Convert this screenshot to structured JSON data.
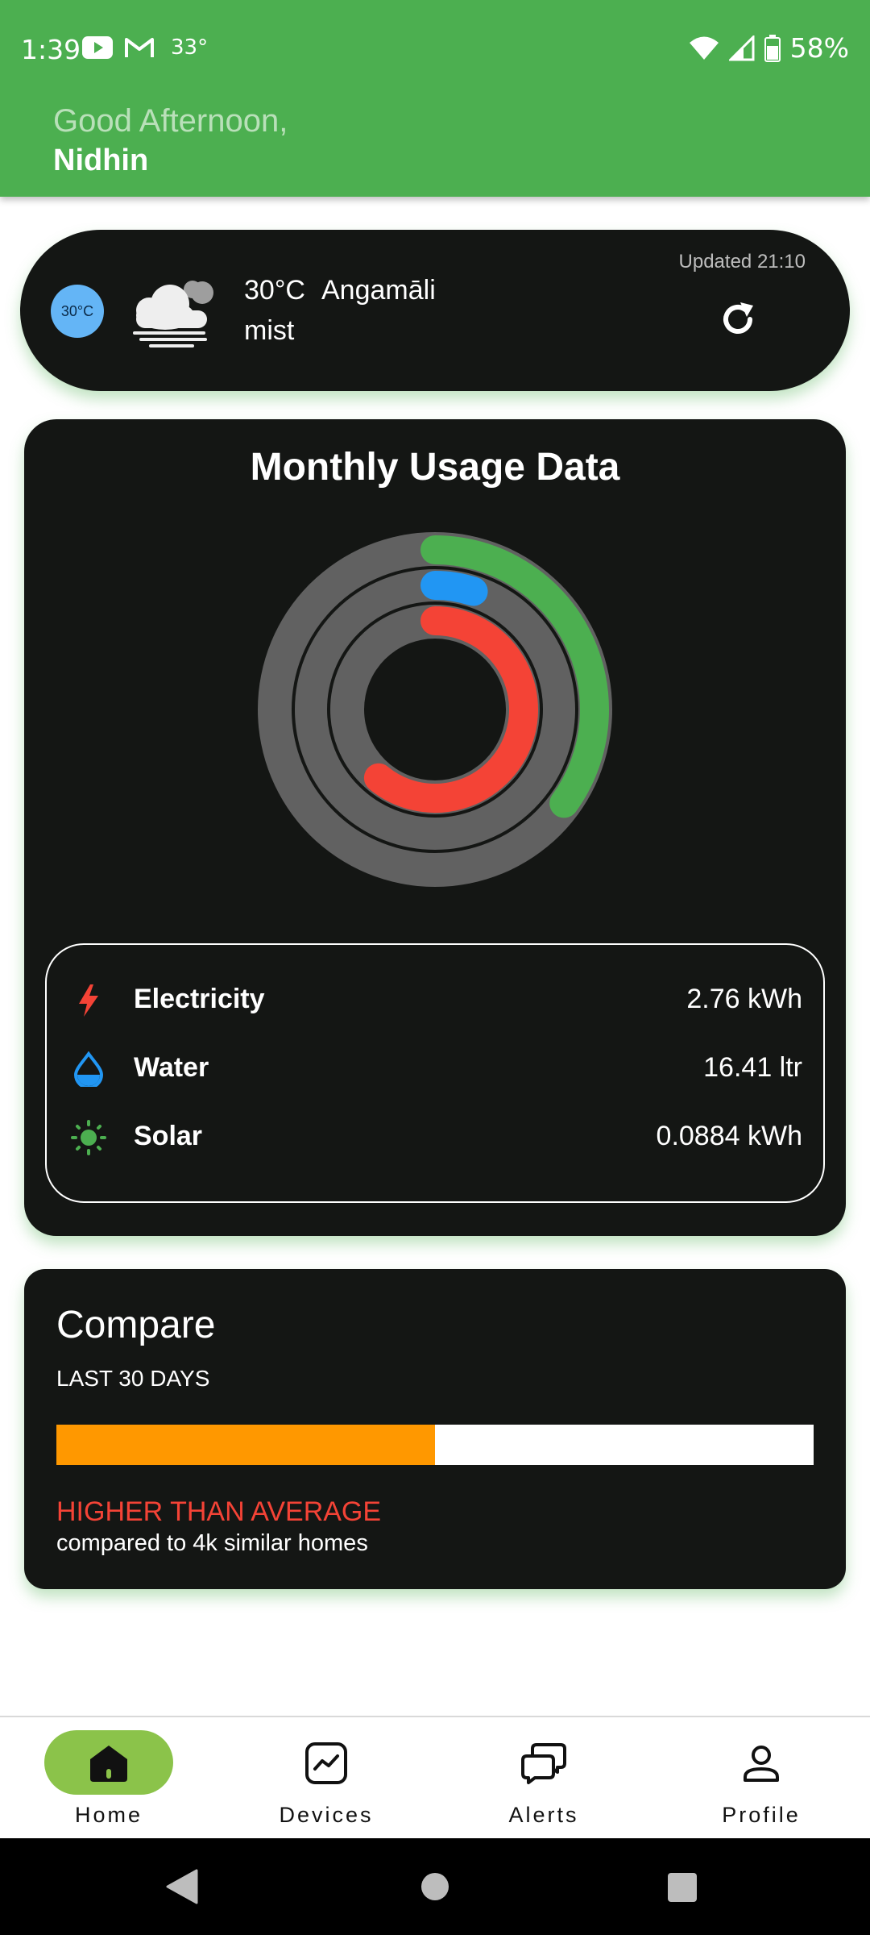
{
  "status_bar": {
    "time": "1:39",
    "temp": "33°",
    "battery": "58%"
  },
  "header": {
    "greeting": "Good Afternoon,",
    "username": "Nidhin"
  },
  "weather": {
    "badge": "30°C",
    "temperature": "30°C",
    "city": "Angamāli",
    "description": "mist",
    "updated": "Updated 21:10",
    "icon": "cloud-mist-icon"
  },
  "usage": {
    "title": "Monthly Usage Data",
    "rings": [
      {
        "name": "Solar",
        "color": "#4caf50",
        "fraction": 0.35
      },
      {
        "name": "Water",
        "color": "#2196f3",
        "fraction": 0.05
      },
      {
        "name": "Electricity",
        "color": "#f44336",
        "fraction": 0.61
      }
    ],
    "items": [
      {
        "label": "Electricity",
        "value": "2.76 kWh",
        "icon": "lightning-icon",
        "color": "#f44336"
      },
      {
        "label": "Water",
        "value": "16.41 ltr",
        "icon": "water-drop-icon",
        "color": "#2196f3"
      },
      {
        "label": "Solar",
        "value": "0.0884 kWh",
        "icon": "sun-icon",
        "color": "#4caf50"
      }
    ]
  },
  "compare": {
    "title": "Compare",
    "period": "LAST 30 DAYS",
    "fill_fraction": 0.5,
    "status": "HIGHER THAN AVERAGE",
    "note": "compared to 4k similar homes"
  },
  "nav": {
    "items": [
      {
        "label": "Home",
        "icon": "home-icon",
        "active": true
      },
      {
        "label": "Devices",
        "icon": "devices-chart-icon",
        "active": false
      },
      {
        "label": "Alerts",
        "icon": "alerts-chat-icon",
        "active": false
      },
      {
        "label": "Profile",
        "icon": "profile-icon",
        "active": false
      }
    ]
  },
  "colors": {
    "header": "#4caf50",
    "card": "#141614",
    "ring_track": "#616161",
    "compare_fill": "#ff9800",
    "status_warning": "#f44336"
  }
}
